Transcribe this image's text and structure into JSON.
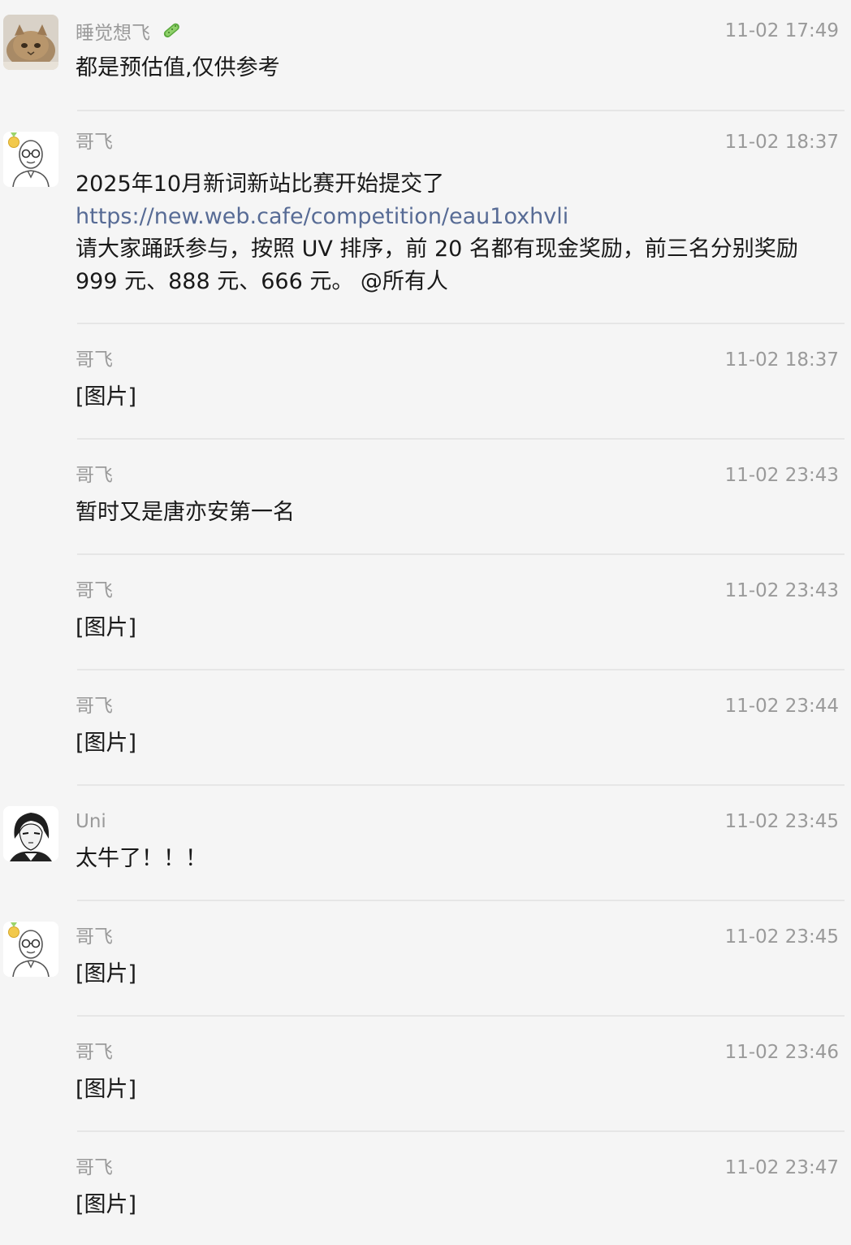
{
  "messages": [
    {
      "sender": "睡觉想飞",
      "sender_emoji": "cucumber-icon",
      "time": "11-02 17:49",
      "avatar": "cat-avatar",
      "lines": [
        "都是预估值,仅供参考"
      ]
    },
    {
      "sender": "哥飞",
      "time": "11-02 18:37",
      "avatar": "glasses-man-avatar",
      "lines": [
        "2025年10月新词新站比赛开始提交了",
        "https://new.web.cafe/competition/eau1oxhvli",
        "请大家踊跃参与，按照 UV 排序，前 20 名都有现金奖励，前三名分别奖励",
        "999 元、888 元、666 元。 @所有人"
      ],
      "link_line_index": 1
    },
    {
      "sender": "哥飞",
      "time": "11-02 18:37",
      "lines": [
        "[图片]"
      ]
    },
    {
      "sender": "哥飞",
      "time": "11-02 23:43",
      "lines": [
        "暂时又是唐亦安第一名"
      ]
    },
    {
      "sender": "哥飞",
      "time": "11-02 23:43",
      "lines": [
        "[图片]"
      ]
    },
    {
      "sender": "哥飞",
      "time": "11-02 23:44",
      "lines": [
        "[图片]"
      ]
    },
    {
      "sender": "Uni",
      "time": "11-02 23:45",
      "avatar": "anime-portrait-avatar",
      "lines": [
        "太牛了！！！"
      ]
    },
    {
      "sender": "哥飞",
      "time": "11-02 23:45",
      "avatar": "glasses-man-avatar",
      "lines": [
        "[图片]"
      ]
    },
    {
      "sender": "哥飞",
      "time": "11-02 23:46",
      "lines": [
        "[图片]"
      ]
    },
    {
      "sender": "哥飞",
      "time": "11-02 23:47",
      "lines": [
        "[图片]"
      ]
    }
  ],
  "colors": {
    "background": "#f5f5f5",
    "meta_text": "#9a9a9a",
    "body_text": "#191919",
    "link": "#576b95",
    "divider": "#e6e6e6"
  }
}
